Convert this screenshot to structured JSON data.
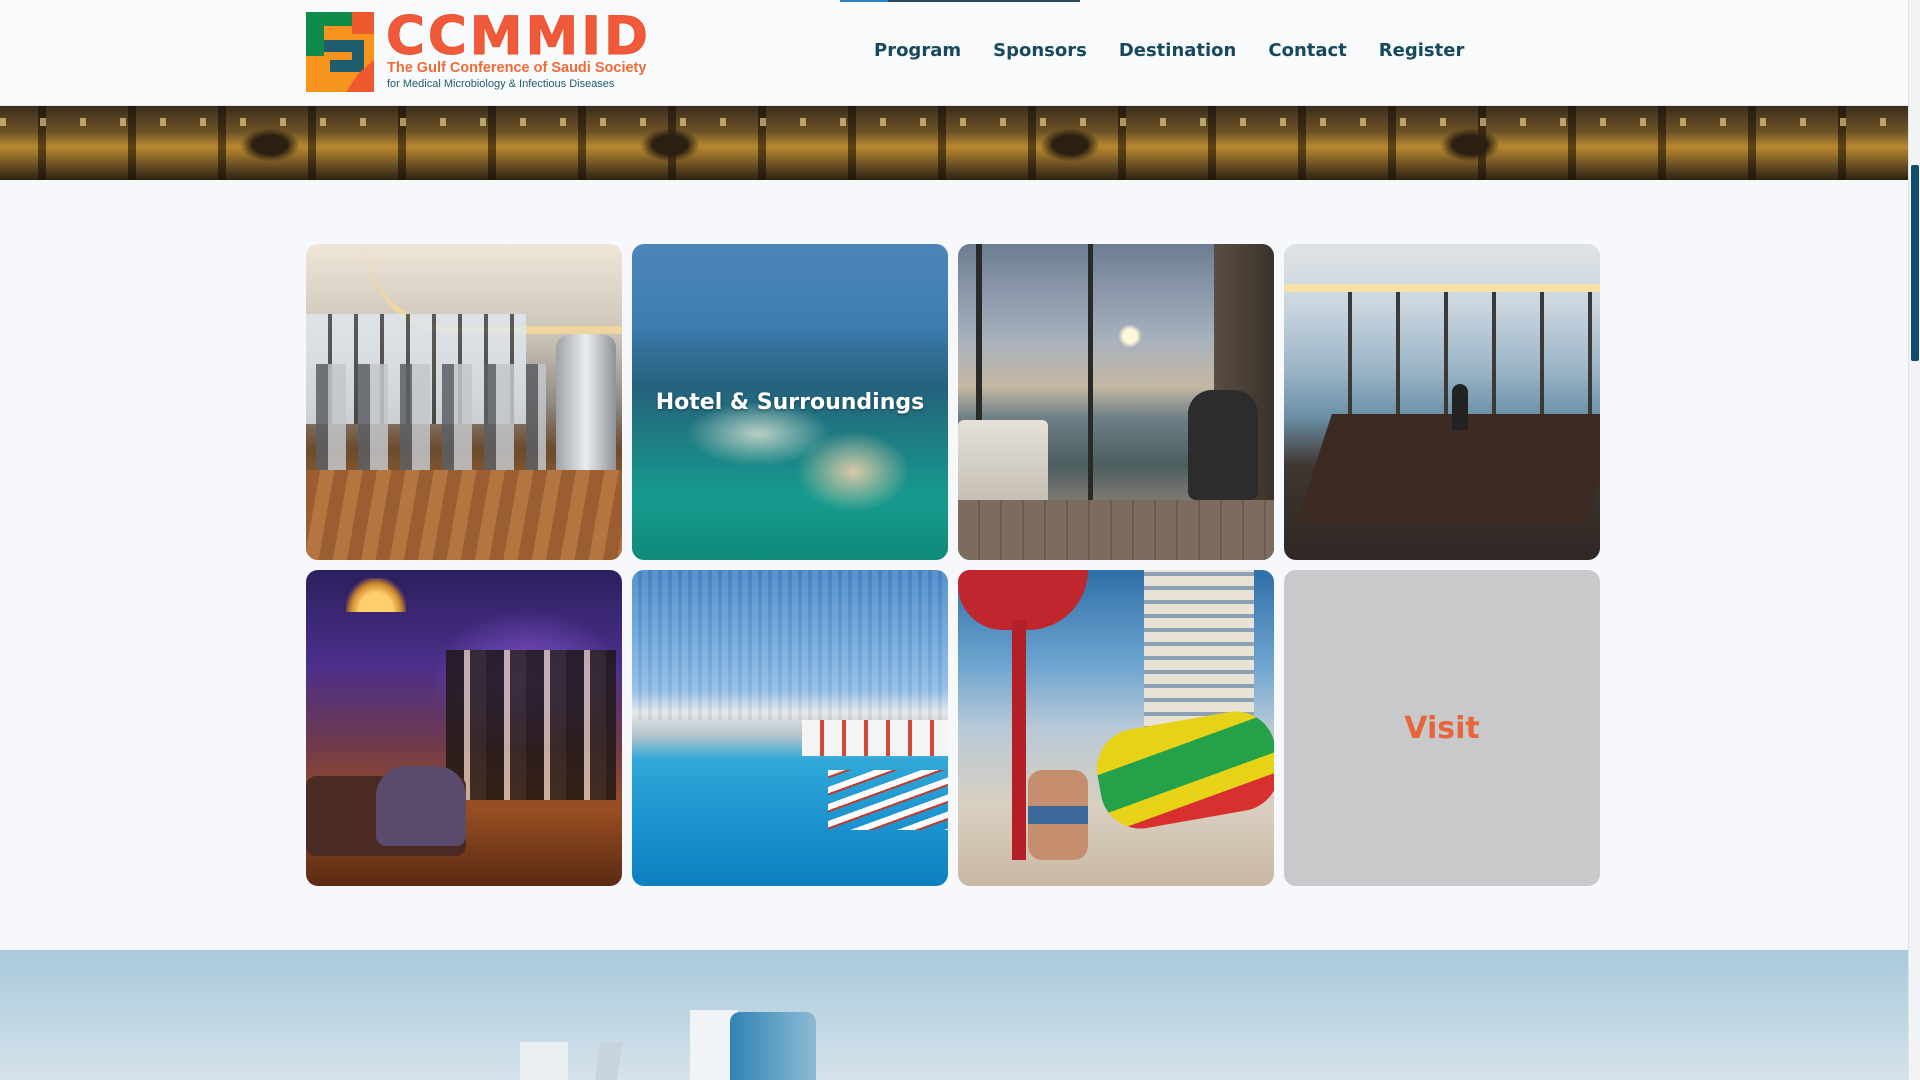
{
  "brand": {
    "name": "CCMMID",
    "tagline_line1": "The Gulf Conference of Saudi Society",
    "tagline_line2": "for Medical Microbiology & Infectious Diseases"
  },
  "nav": {
    "items": [
      {
        "label": "Program"
      },
      {
        "label": "Sponsors"
      },
      {
        "label": "Destination"
      },
      {
        "label": "Contact"
      },
      {
        "label": "Register"
      }
    ]
  },
  "gallery": {
    "tiles": [
      {
        "kind": "photo",
        "subject": "gym",
        "label": ""
      },
      {
        "kind": "overlay",
        "subject": "aerial",
        "label": "Hotel & Surroundings"
      },
      {
        "kind": "photo",
        "subject": "room-view",
        "label": ""
      },
      {
        "kind": "photo",
        "subject": "meeting-room",
        "label": ""
      },
      {
        "kind": "photo",
        "subject": "lounge",
        "label": ""
      },
      {
        "kind": "photo",
        "subject": "pool",
        "label": ""
      },
      {
        "kind": "photo",
        "subject": "water-park",
        "label": ""
      },
      {
        "kind": "link",
        "subject": "visit",
        "label": "Visit"
      }
    ]
  },
  "colors": {
    "brand_orange": "#f05a3a",
    "nav_text": "#16495e",
    "visit_text": "#e8643a",
    "visit_bg": "#c8c9cb",
    "scroll_thumb": "#0f4c6e"
  }
}
